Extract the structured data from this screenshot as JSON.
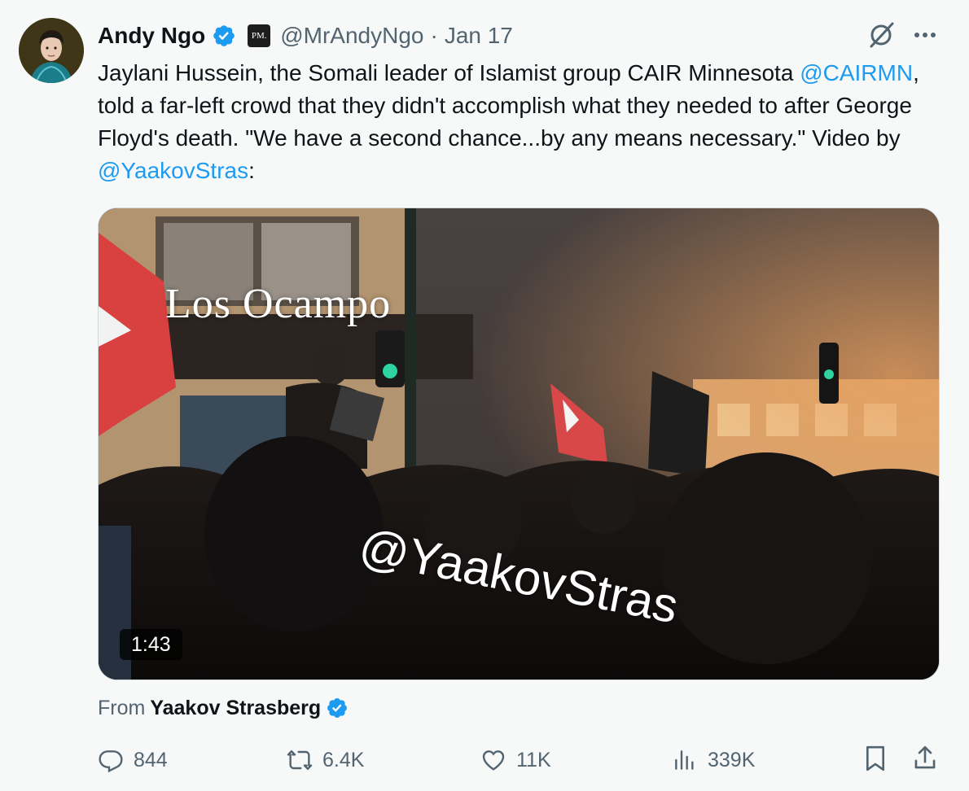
{
  "tweet": {
    "author_name": "Andy Ngo",
    "affiliation_badge": "PM.",
    "handle": "@MrAndyNgo",
    "separator": "·",
    "date": "Jan 17",
    "text": {
      "part1": "Jaylani Hussein, the Somali leader of Islamist group CAIR Minnesota ",
      "mention1": "@CAIRMN",
      "part2": ", told a far-left crowd that they didn't accomplish what they needed to after George Floyd's death. \"We have a second chance...by any means necessary.\" Video by ",
      "mention2": "@YaakovStras",
      "part3": ":"
    },
    "media": {
      "sign_text": "Los Ocampo",
      "watermark": "@YaakovStras",
      "duration": "1:43"
    },
    "from": {
      "label": "From",
      "name": "Yaakov Strasberg"
    },
    "actions": {
      "replies": "844",
      "reposts": "6.4K",
      "likes": "11K",
      "views": "339K"
    }
  },
  "colors": {
    "accent": "#1d9bf0",
    "secondary_text": "#536471",
    "primary_text": "#0f1419",
    "background": "#f7f9f9"
  },
  "icons": [
    "verified-badge-icon",
    "grok-icon",
    "more-icon",
    "reply-icon",
    "repost-icon",
    "like-icon",
    "views-icon",
    "bookmark-icon",
    "share-icon"
  ]
}
